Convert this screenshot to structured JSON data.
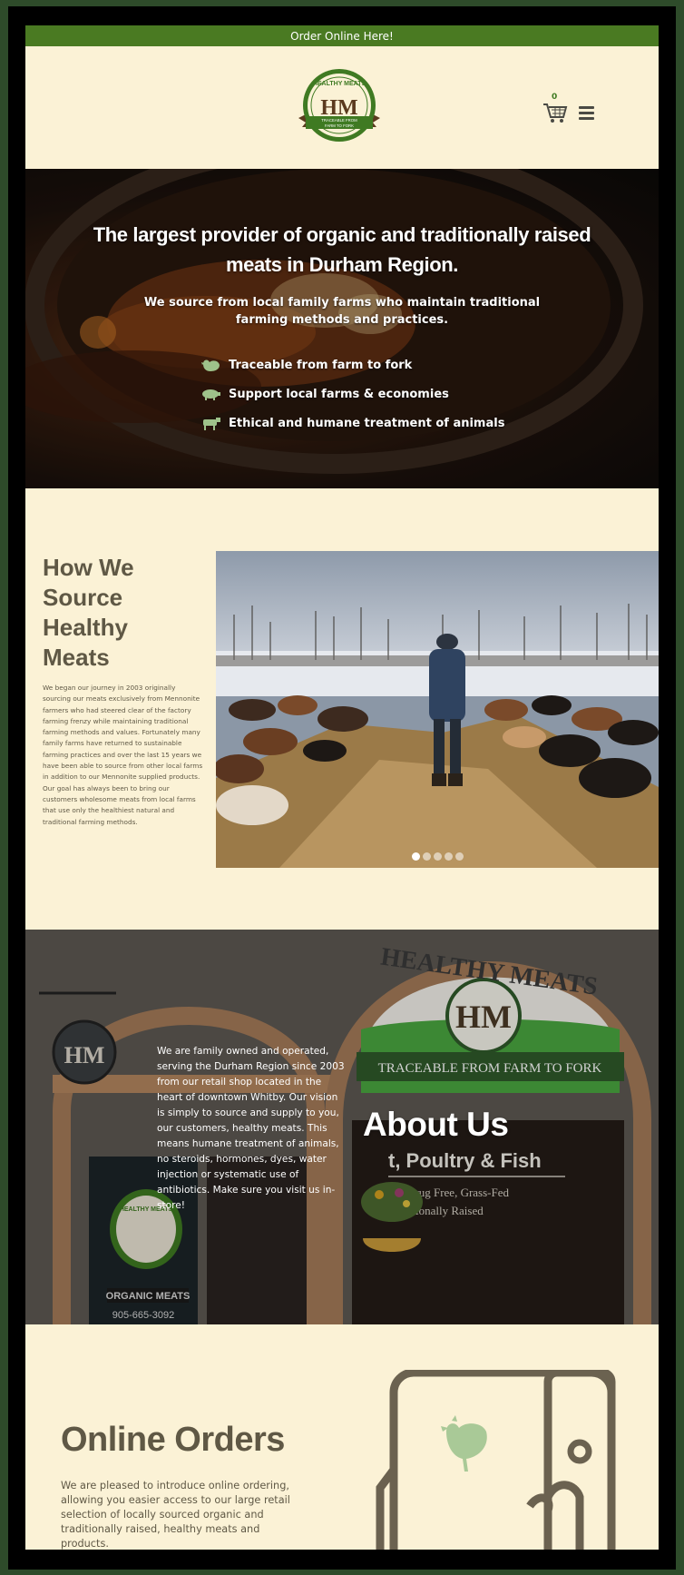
{
  "topbar": {
    "text": "Order Online Here!"
  },
  "header": {
    "logo": {
      "top_text": "HEALTHY MEATS",
      "monogram": "HM",
      "ribbon_text": "TRACEABLE FROM FARM TO FORK"
    },
    "cart_count": "0",
    "cart_icon": "cart-icon",
    "menu_icon": "hamburger-menu-icon"
  },
  "hero": {
    "title": "The largest provider of organic and traditionally raised meats in Durham Region.",
    "subtitle": "We source from local family farms who maintain traditional farming methods and practices.",
    "features": [
      {
        "icon": "chicken-icon",
        "label": "Traceable from farm to fork"
      },
      {
        "icon": "pig-icon",
        "label": "Support local farms & economies"
      },
      {
        "icon": "cow-icon",
        "label": "Ethical and humane treatment of animals"
      }
    ]
  },
  "source": {
    "title": "How We Source Healthy Meats",
    "body": "We began our journey in 2003 originally sourcing our meats exclusively from Mennonite farmers who had steered clear of the factory farming frenzy while maintaining traditional farming methods and values. Fortunately many family farms have returned to sustainable farming practices and over the last 15 years we have been able to source from other local farms in addition to our Mennonite supplied products. Our goal has always been to bring our customers wholesome meats from local farms that use only the healthiest natural and traditional farming methods.",
    "slider": {
      "dots": 5,
      "active_index": 0
    }
  },
  "about": {
    "text": "We are family owned and operated, serving the Durham Region since 2003 from our retail shop located in the heart of downtown Whitby. Our vision is simply to source and supply to you, our customers, healthy meats. This means humane treatment of animals, no steroids, hormones, dyes, water injection or systematic use of antibiotics. Make sure you visit us in-store!",
    "title": "About Us",
    "sign": {
      "arch_text": "HEALTHY MEATS",
      "monogram": "HM",
      "banner_text": "TRACEABLE FROM FARM TO FORK",
      "window_line1": "t, Poultry & Fish",
      "window_line2": "Drug Free, Grass-Fed",
      "window_line3": "ionally Raised",
      "door_label": "ORGANIC MEATS",
      "door_phone": "905-665-3092",
      "door_logo_text": "HEALTHY MEATS"
    }
  },
  "orders": {
    "title": "Online Orders",
    "body": "We are pleased to introduce online ordering, allowing you easier access to our large retail selection of locally sourced organic and traditionally raised, healthy meats and products."
  },
  "colors": {
    "green": "#4a7a22",
    "cream": "#fbf2d6",
    "brown_text": "#5f5845",
    "frame": "#2e4b2a"
  }
}
